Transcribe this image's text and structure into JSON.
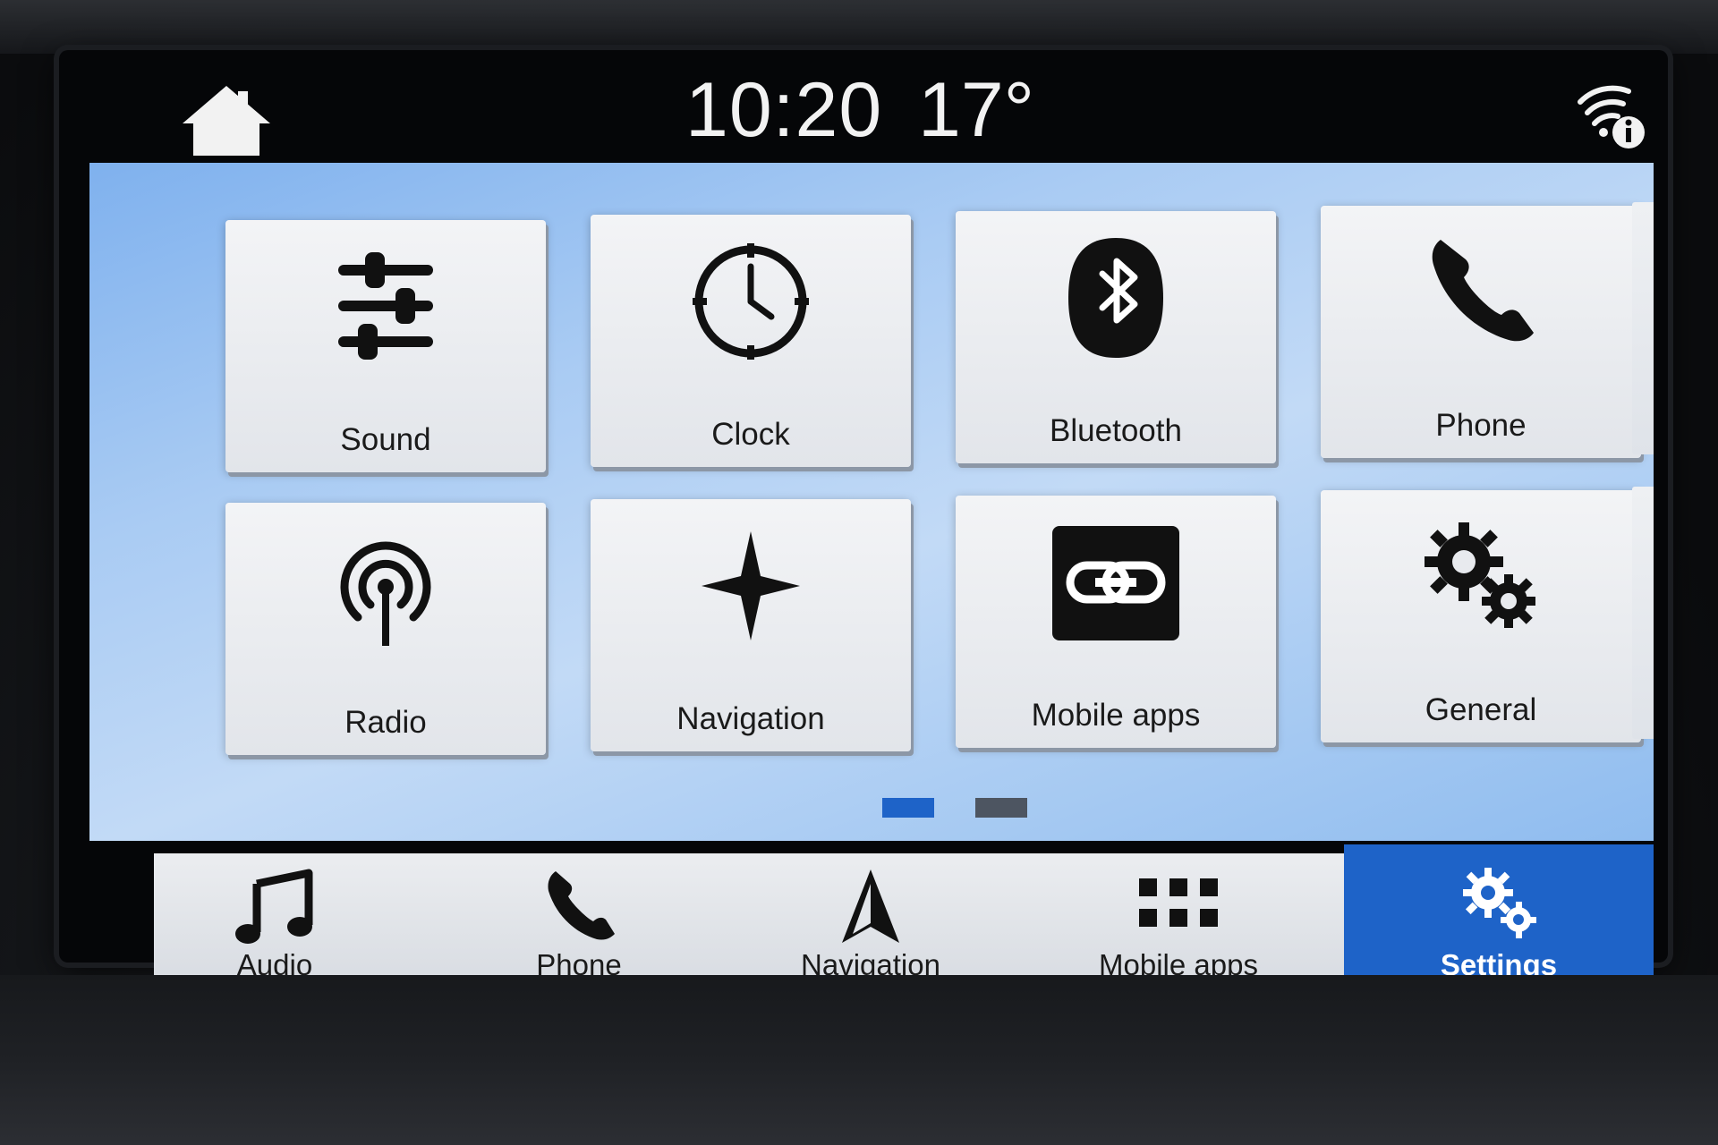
{
  "status_bar": {
    "time": "10:20",
    "temperature": "17°"
  },
  "colors": {
    "accent": "#1e63c8",
    "page_indicator_active": "#1e63c8",
    "page_indicator_inactive": "#4d5561"
  },
  "settings_grid": {
    "tiles": [
      {
        "label": "Sound",
        "icon": "sliders-icon"
      },
      {
        "label": "Clock",
        "icon": "clock-icon"
      },
      {
        "label": "Bluetooth",
        "icon": "bluetooth-icon"
      },
      {
        "label": "Phone",
        "icon": "phone-icon"
      },
      {
        "label": "Radio",
        "icon": "radio-antenna-icon"
      },
      {
        "label": "Navigation",
        "icon": "compass-star-icon"
      },
      {
        "label": "Mobile apps",
        "icon": "link-icon"
      },
      {
        "label": "General",
        "icon": "gears-icon"
      }
    ],
    "page_indicator": {
      "pages": 2,
      "current_page": 1
    }
  },
  "bottom_nav": {
    "items": [
      {
        "label": "Audio",
        "icon": "music-note-icon",
        "active": false
      },
      {
        "label": "Phone",
        "icon": "phone-icon",
        "active": false
      },
      {
        "label": "Navigation",
        "icon": "nav-arrow-icon",
        "active": false
      },
      {
        "label": "Mobile apps",
        "icon": "apps-grid-icon",
        "active": false
      },
      {
        "label": "Settings",
        "icon": "gears-icon",
        "active": true
      }
    ]
  }
}
